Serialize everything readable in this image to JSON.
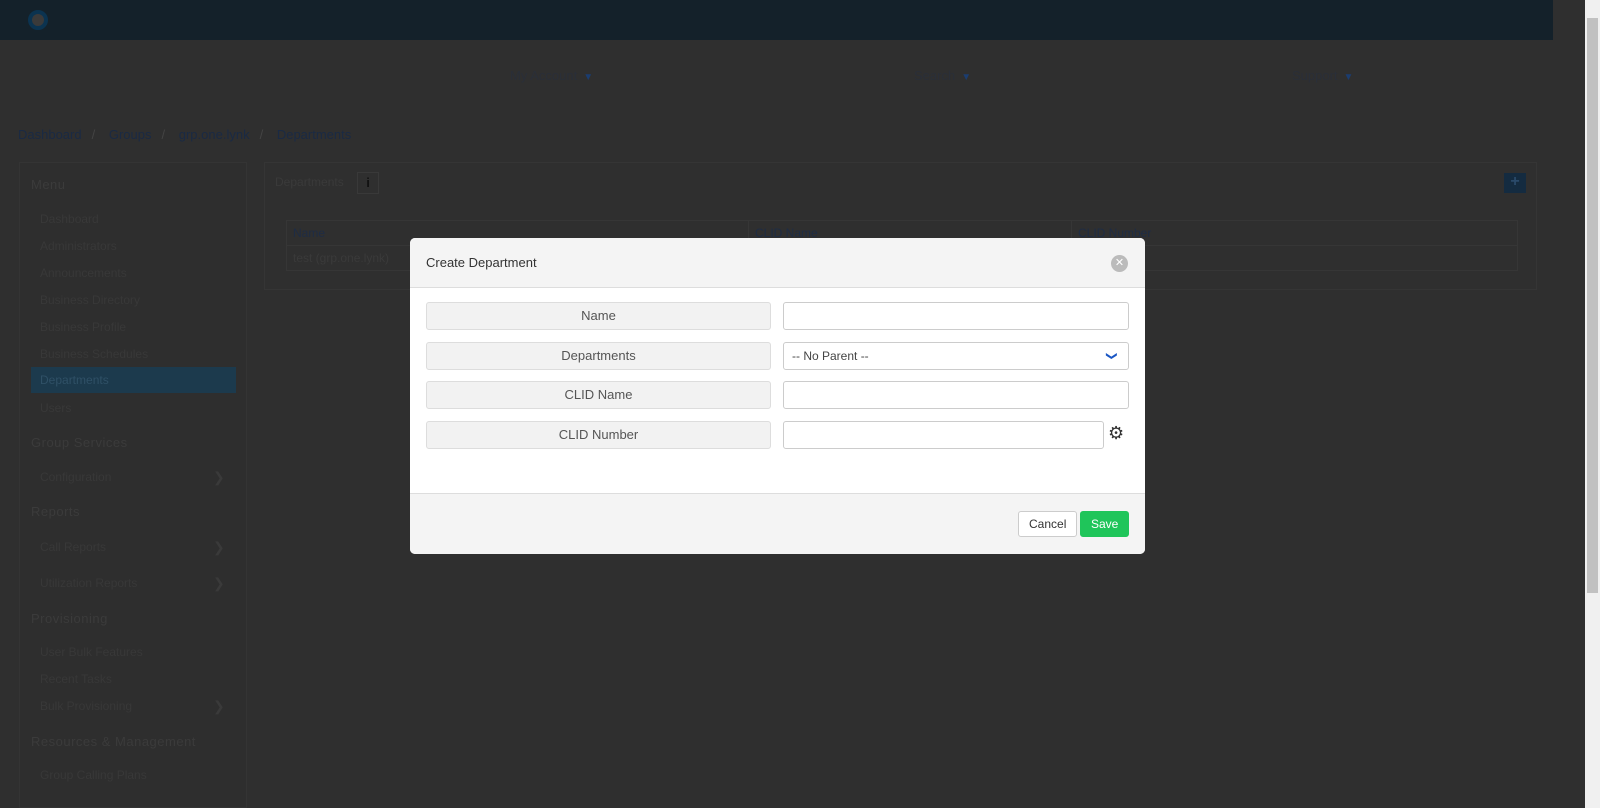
{
  "nav": {
    "items": [
      {
        "label": "My Account"
      },
      {
        "label": "Search"
      },
      {
        "label": "Support"
      }
    ]
  },
  "breadcrumb": [
    "Dashboard",
    "Groups",
    "grp.one.lynk",
    "Departments"
  ],
  "sidebar": {
    "menu_title": "Menu",
    "menu_items": [
      "Dashboard",
      "Administrators",
      "Announcements",
      "Business Directory",
      "Business Profile",
      "Business Schedules",
      "Departments",
      "Users"
    ],
    "active": "Departments",
    "group_services": "Group Services",
    "configuration": "Configuration",
    "reports": "Reports",
    "call_reports": "Call Reports",
    "utilization_reports": "Utilization Reports",
    "provisioning": "Provisioning",
    "user_bulk_features": "User Bulk Features",
    "recent_tasks": "Recent Tasks",
    "bulk_provisioning": "Bulk Provisioning",
    "resources": "Resources & Management",
    "group_calling_plans": "Group Calling Plans"
  },
  "panel": {
    "title": "Departments",
    "columns": [
      "Name",
      "CLID Name",
      "CLID Number"
    ],
    "rows": [
      [
        "test (grp.one.lynk)",
        "",
        "504"
      ]
    ]
  },
  "modal": {
    "title": "Create Department",
    "fields": {
      "name": "Name",
      "departments": "Departments",
      "clid_name": "CLID Name",
      "clid_number": "CLID Number"
    },
    "departments_value": "-- No Parent --",
    "cancel": "Cancel",
    "save": "Save"
  },
  "colors": {
    "save": "#1fc55a",
    "active_item": "#1c3a4d"
  }
}
